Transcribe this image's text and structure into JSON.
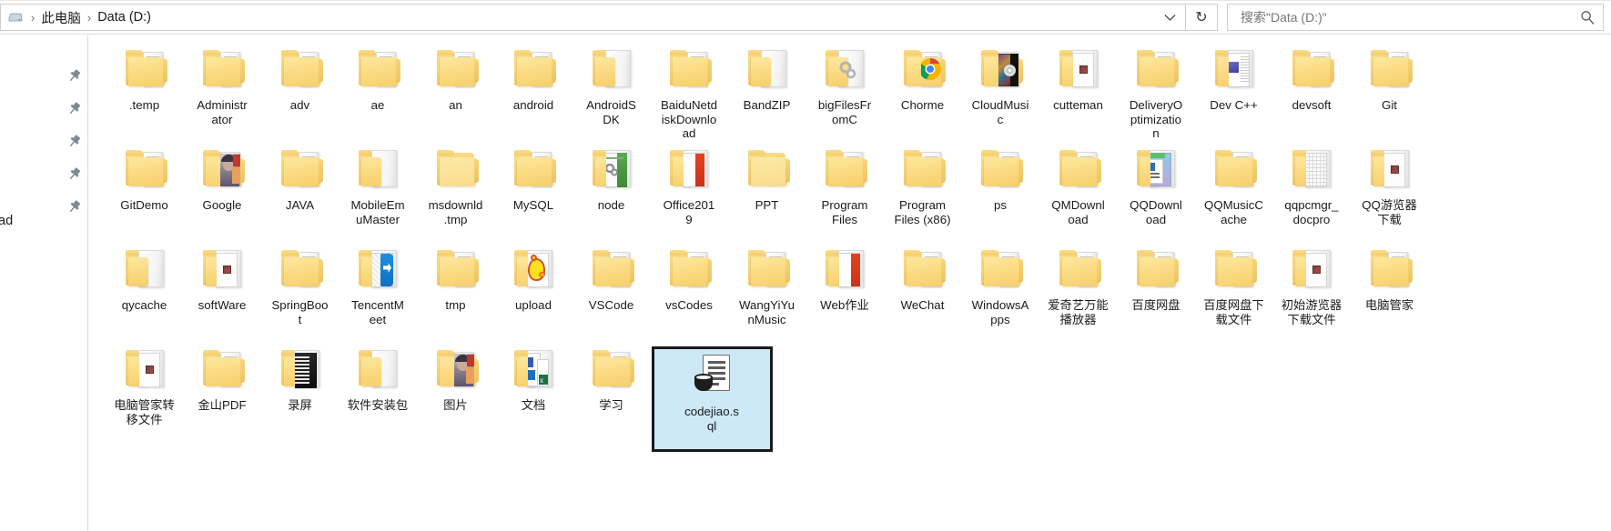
{
  "window": {
    "addressbar": {
      "root_icon": "drive-icon",
      "separator": "›",
      "crumbs": [
        "此电脑",
        "Data (D:)"
      ],
      "dropdown_icon": "chevron-down-icon",
      "refresh_icon": "refresh-icon",
      "refresh_glyph": "↻"
    },
    "search": {
      "placeholder": "搜索\"Data (D:)\"",
      "value": "",
      "icon": "search-icon"
    }
  },
  "left_rail": {
    "pin_icon": "pin-icon",
    "pin_count": 5,
    "clipped_text": "ad"
  },
  "grid": {
    "rows": [
      {
        "items": [
          {
            "name": ".temp",
            "icon": "folder-icon"
          },
          {
            "name": "Administr\nator",
            "icon": "folder-icon"
          },
          {
            "name": "adv",
            "icon": "folder-icon"
          },
          {
            "name": "ae",
            "icon": "folder-icon"
          },
          {
            "name": "an",
            "icon": "folder-icon"
          },
          {
            "name": "android",
            "icon": "folder-icon"
          },
          {
            "name": "AndroidS\nDK",
            "icon": "folder-document-icon"
          },
          {
            "name": "BaiduNetd\niskDownlo\nad",
            "icon": "folder-icon"
          },
          {
            "name": "BandZIP",
            "icon": "folder-document-icon"
          },
          {
            "name": "bigFilesFr\nomC",
            "icon": "folder-gears-icon"
          },
          {
            "name": "Chorme",
            "icon": "folder-chrome-icon"
          },
          {
            "name": "CloudMusi\nc",
            "icon": "folder-album-icon"
          },
          {
            "name": "cutteman",
            "icon": "folder-thumb-icon"
          },
          {
            "name": "DeliveryO\nptimizatio\nn",
            "icon": "folder-icon"
          },
          {
            "name": "Dev C++",
            "icon": "folder-page-icon"
          },
          {
            "name": "devsoft",
            "icon": "folder-icon"
          },
          {
            "name": "Git",
            "icon": "folder-icon"
          }
        ]
      },
      {
        "items": [
          {
            "name": "GitDemo",
            "icon": "folder-icon"
          },
          {
            "name": "Google",
            "icon": "folder-photo-icon"
          },
          {
            "name": "JAVA",
            "icon": "folder-icon"
          },
          {
            "name": "MobileEm\nuMaster",
            "icon": "folder-document-icon"
          },
          {
            "name": "msdownld\n.tmp",
            "icon": "folder-empty-icon"
          },
          {
            "name": "MySQL",
            "icon": "folder-icon"
          },
          {
            "name": "node",
            "icon": "folder-green-icon"
          },
          {
            "name": "Office201\n9",
            "icon": "folder-red-icon"
          },
          {
            "name": "PPT",
            "icon": "folder-empty-icon"
          },
          {
            "name": "Program\nFiles",
            "icon": "folder-icon"
          },
          {
            "name": "Program\nFiles (x86)",
            "icon": "folder-icon"
          },
          {
            "name": "ps",
            "icon": "folder-icon"
          },
          {
            "name": "QMDownl\noad",
            "icon": "folder-icon"
          },
          {
            "name": "QQDownl\noad",
            "icon": "folder-qqdoc-icon"
          },
          {
            "name": "QQMusicC\nache",
            "icon": "folder-icon"
          },
          {
            "name": "qqpcmgr_\ndocpro",
            "icon": "folder-grid-icon"
          },
          {
            "name": "QQ游览器\n下载",
            "icon": "folder-thumb-icon"
          }
        ]
      },
      {
        "items": [
          {
            "name": "qycache",
            "icon": "folder-document-icon"
          },
          {
            "name": "softWare",
            "icon": "folder-thumb-icon"
          },
          {
            "name": "SpringBoo\nt",
            "icon": "folder-icon"
          },
          {
            "name": "TencentM\neet",
            "icon": "folder-blue-icon"
          },
          {
            "name": "tmp",
            "icon": "folder-icon"
          },
          {
            "name": "upload",
            "icon": "folder-chick-icon"
          },
          {
            "name": "VSCode",
            "icon": "folder-icon"
          },
          {
            "name": "vsCodes",
            "icon": "folder-icon"
          },
          {
            "name": "WangYiYu\nnMusic",
            "icon": "folder-icon"
          },
          {
            "name": "Web作业",
            "icon": "folder-red-icon"
          },
          {
            "name": "WeChat",
            "icon": "folder-icon"
          },
          {
            "name": "WindowsA\npps",
            "icon": "folder-icon"
          },
          {
            "name": "爱奇艺万能\n播放器",
            "icon": "folder-icon"
          },
          {
            "name": "百度网盘",
            "icon": "folder-icon"
          },
          {
            "name": "百度网盘下\n载文件",
            "icon": "folder-icon"
          },
          {
            "name": "初始游览器\n下载文件",
            "icon": "folder-thumb-icon"
          },
          {
            "name": "电脑管家",
            "icon": "folder-icon"
          }
        ]
      },
      {
        "items": [
          {
            "name": "电脑管家转\n移文件",
            "icon": "folder-thumb-icon"
          },
          {
            "name": "金山PDF",
            "icon": "folder-icon"
          },
          {
            "name": "录屏",
            "icon": "folder-dark-icon"
          },
          {
            "name": "软件安装包",
            "icon": "folder-document-icon"
          },
          {
            "name": "图片",
            "icon": "folder-photo-icon"
          },
          {
            "name": "文档",
            "icon": "folder-office-icon"
          },
          {
            "name": "学习",
            "icon": "folder-icon"
          },
          {
            "name": "codejiao.s\nql",
            "icon": "sql-file-icon",
            "selected": true
          }
        ]
      }
    ]
  },
  "colors": {
    "folder_yellow": "#fbdc85",
    "selection_fill": "#cde8f7",
    "selection_border": "#1a1a1a",
    "text": "#1b1b1b",
    "placeholder": "#767676"
  }
}
